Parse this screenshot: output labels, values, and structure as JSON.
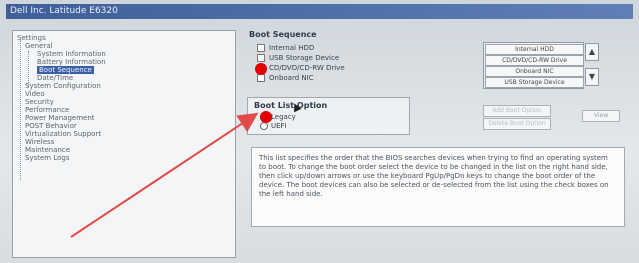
{
  "window": {
    "title": "Dell Inc. Latitude E6320"
  },
  "sidebar": {
    "items": [
      {
        "label": "Settings",
        "indent": 0
      },
      {
        "label": "General",
        "indent": 1
      },
      {
        "label": "System Information",
        "indent": 2
      },
      {
        "label": "Battery Information",
        "indent": 2
      },
      {
        "label": "Boot Sequence",
        "indent": 2,
        "selected": true
      },
      {
        "label": "Date/Time",
        "indent": 2
      },
      {
        "label": "System Configuration",
        "indent": 1
      },
      {
        "label": "Video",
        "indent": 1
      },
      {
        "label": "Security",
        "indent": 1
      },
      {
        "label": "Performance",
        "indent": 1
      },
      {
        "label": "Power Management",
        "indent": 1
      },
      {
        "label": "POST Behavior",
        "indent": 1
      },
      {
        "label": "Virtualization Support",
        "indent": 1
      },
      {
        "label": "Wireless",
        "indent": 1
      },
      {
        "label": "Maintenance",
        "indent": 1
      },
      {
        "label": "System Logs",
        "indent": 1
      }
    ]
  },
  "boot_sequence": {
    "title": "Boot Sequence",
    "devices": [
      "Internal HDD",
      "USB Storage Device",
      "CD/DVD/CD-RW Drive",
      "Onboard NIC"
    ],
    "order_list": [
      "Internal HDD",
      "CD/DVD/CD-RW Drive",
      "Onboard NIC",
      "USB Storage Device"
    ]
  },
  "boot_list_option": {
    "title": "Boot List Option",
    "options": [
      {
        "label": "Legacy",
        "checked": true
      },
      {
        "label": "UEFI",
        "checked": false
      }
    ]
  },
  "actions": {
    "add": "Add Boot Option",
    "delete": "Delete Boot Option",
    "view": "View"
  },
  "description": "This list specifies the order that the BIOS searches devices when trying to find an operating system to boot. To change the boot order select the device to be changed in the list on the right hand side, then click up/down arrows or use the keyboard PgUp/PgDn keys to change the boot order of the device. The boot devices can also be selected or de-selected from the list using the check boxes on the left hand side.",
  "colors": {
    "accent_red": "#e10000",
    "selection_blue": "#3b5ea8"
  }
}
